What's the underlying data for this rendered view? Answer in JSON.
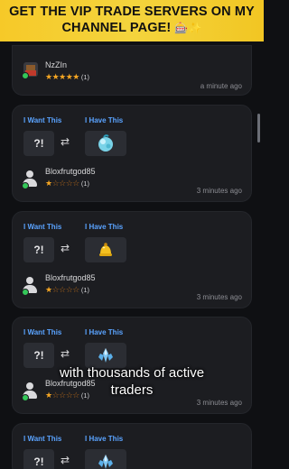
{
  "banner": {
    "text": "GET THE VIP TRADE SERVERS ON MY",
    "text2": "CHANNEL PAGE!",
    "emoji": "🎰✨"
  },
  "first": {
    "username": "NzZIn",
    "stars_full": "★★★★★",
    "stars_empty": "",
    "count": "(1)",
    "time": "a minute ago"
  },
  "trades": [
    {
      "want_label": "I Want This",
      "have_label": "I Have This",
      "want_item": "?!",
      "swap_icon": "⇄",
      "have_item_icon": "blue-orb-fruit-icon",
      "username": "Bloxfrutgod85",
      "stars_full": "★",
      "stars_empty": "☆☆☆☆",
      "count": "(1)",
      "time": "3 minutes ago"
    },
    {
      "want_label": "I Want This",
      "have_label": "I Have This",
      "want_item": "?!",
      "swap_icon": "⇄",
      "have_item_icon": "yellow-bell-fruit-icon",
      "username": "Bloxfrutgod85",
      "stars_full": "★",
      "stars_empty": "☆☆☆☆",
      "count": "(1)",
      "time": "3 minutes ago"
    },
    {
      "want_label": "I Want This",
      "have_label": "I Have This",
      "want_item": "?!",
      "swap_icon": "⇄",
      "have_item_icon": "ice-crystal-fruit-icon",
      "username": "Bloxfrutgod85",
      "stars_full": "★",
      "stars_empty": "☆☆☆☆",
      "count": "(1)",
      "time": "3 minutes ago"
    },
    {
      "want_label": "I Want This",
      "have_label": "I Have This",
      "want_item": "?!",
      "swap_icon": "⇄",
      "have_item_icon": "ice-crystal-fruit-icon"
    }
  ],
  "subtitle": {
    "line1": "with thousands of active",
    "line2": "traders"
  }
}
